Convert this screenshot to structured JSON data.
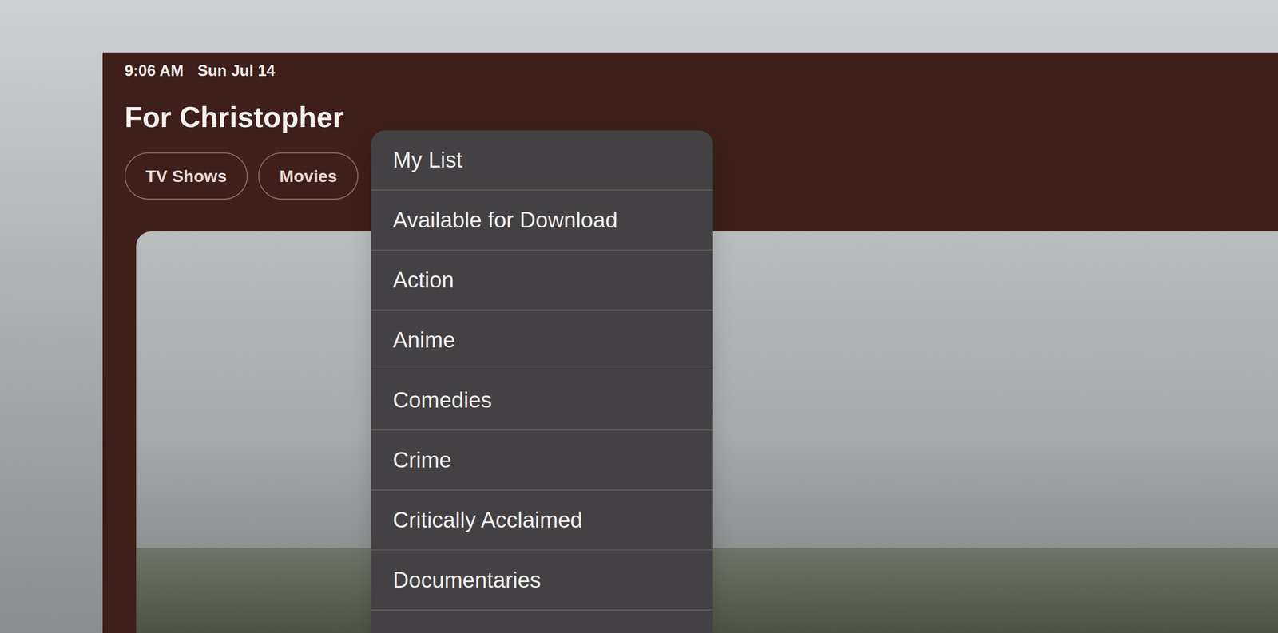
{
  "status_bar": {
    "time": "9:06 AM",
    "date": "Sun Jul 14"
  },
  "header": {
    "title": "For Christopher"
  },
  "filters": [
    {
      "label": "TV Shows",
      "selected": false
    },
    {
      "label": "Movies",
      "selected": false
    }
  ],
  "menu": {
    "open": true,
    "items": [
      {
        "label": "My List"
      },
      {
        "label": "Available for Download"
      },
      {
        "label": "Action"
      },
      {
        "label": "Anime"
      },
      {
        "label": "Comedies"
      },
      {
        "label": "Crime"
      },
      {
        "label": "Critically Acclaimed"
      },
      {
        "label": "Documentaries"
      }
    ]
  }
}
